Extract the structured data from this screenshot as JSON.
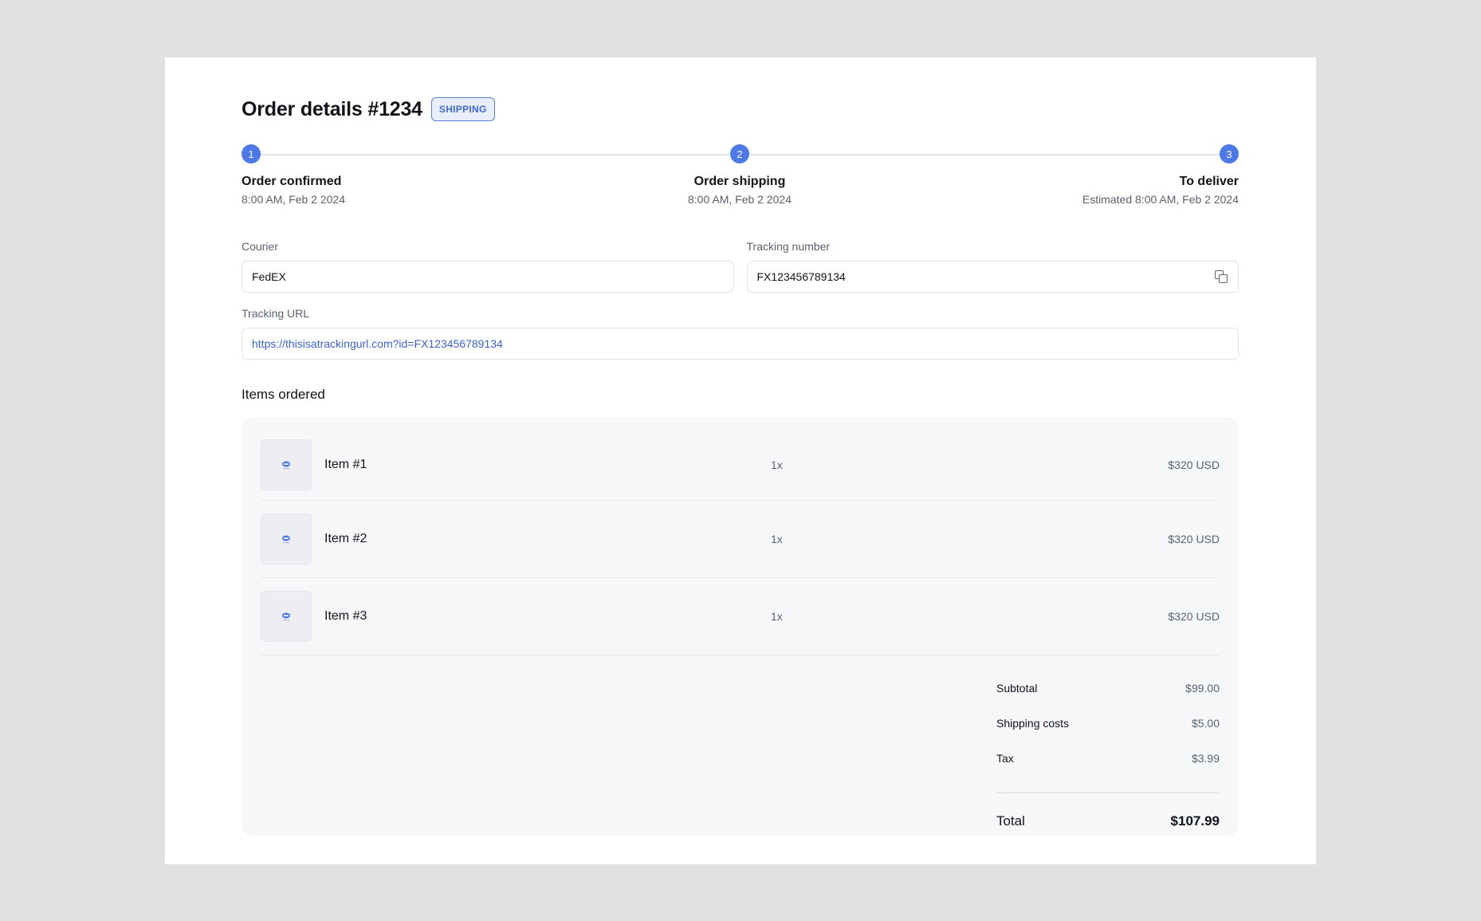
{
  "order": {
    "title": "Order details #1234",
    "status_badge": "SHIPPING"
  },
  "steps": [
    {
      "number": "1",
      "label": "Order confirmed",
      "time": "8:00 AM, Feb 2 2024"
    },
    {
      "number": "2",
      "label": "Order shipping",
      "time": "8:00 AM, Feb 2 2024"
    },
    {
      "number": "3",
      "label": "To deliver",
      "time": "Estimated 8:00 AM, Feb 2 2024"
    }
  ],
  "fields": {
    "courier_label": "Courier",
    "courier_value": "FedEX",
    "tracking_number_label": "Tracking number",
    "tracking_number_value": "FX123456789134",
    "tracking_url_label": "Tracking URL",
    "tracking_url_value": "https://thisisatrackingurl.com?id=FX123456789134"
  },
  "items_section": {
    "title": "Items ordered",
    "items": [
      {
        "name": "Item #1",
        "qty": "1x",
        "price": "$320 USD"
      },
      {
        "name": "Item #2",
        "qty": "1x",
        "price": "$320 USD"
      },
      {
        "name": "Item #3",
        "qty": "1x",
        "price": "$320 USD"
      }
    ]
  },
  "totals": {
    "subtotal_label": "Subtotal",
    "subtotal_value": "$99.00",
    "shipping_label": "Shipping costs",
    "shipping_value": "$5.00",
    "tax_label": "Tax",
    "tax_value": "$3.99",
    "total_label": "Total",
    "total_value": "$107.99"
  },
  "colors": {
    "accent": "#4d78e8",
    "link": "#3b63d3",
    "background": "#e1e1e1",
    "panel": "#f6f7f9"
  },
  "icons": {
    "copy": "copy-icon",
    "item_image": "image-placeholder-icon"
  }
}
